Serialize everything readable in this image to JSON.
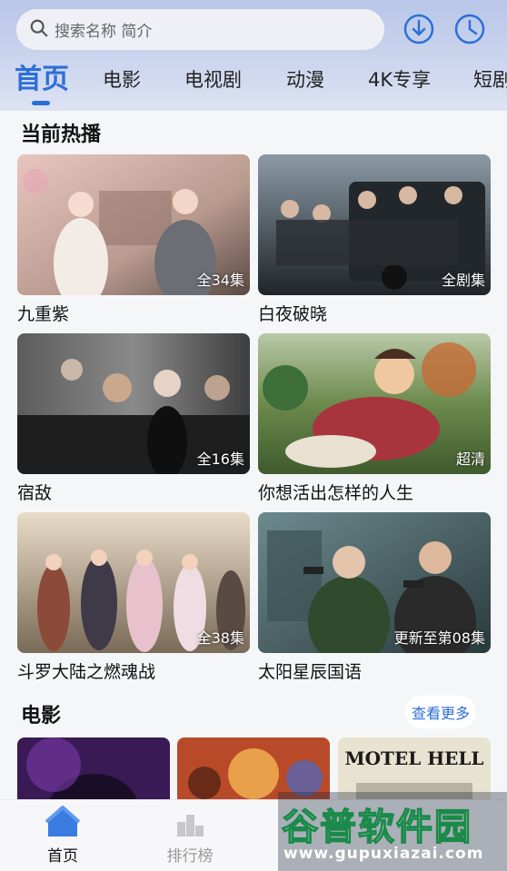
{
  "search": {
    "placeholder": "搜索名称 简介"
  },
  "header": {
    "download_icon": "download-icon",
    "history_icon": "clock-icon"
  },
  "tabs": [
    {
      "label": "首页",
      "active": true
    },
    {
      "label": "电影"
    },
    {
      "label": "电视剧"
    },
    {
      "label": "动漫"
    },
    {
      "label": "4K专享"
    },
    {
      "label": "短剧"
    }
  ],
  "sections": {
    "now_playing": {
      "title": "当前热播",
      "items": [
        {
          "title": "九重紫",
          "badge": "全34集"
        },
        {
          "title": "白夜破晓",
          "badge": "全剧集"
        },
        {
          "title": "宿敌",
          "badge": "全16集"
        },
        {
          "title": "你想活出怎样的人生",
          "badge": "超清"
        },
        {
          "title": "斗罗大陆之燃魂战",
          "badge": "全38集"
        },
        {
          "title": "太阳星辰国语",
          "badge": "更新至第08集"
        }
      ]
    },
    "movies": {
      "title": "电影",
      "more_label": "查看更多",
      "poster3_text": "MOTEL HELL"
    }
  },
  "bottom_nav": [
    {
      "label": "首页",
      "icon": "home-icon",
      "active": true
    },
    {
      "label": "排行榜",
      "icon": "ranking-icon"
    }
  ],
  "watermark": {
    "name": "谷普软件园",
    "url": "www.gupuxiazai.com"
  },
  "colors": {
    "accent": "#2c6fd8",
    "topbar": "#c3cdea",
    "background": "#f5f6f8"
  }
}
